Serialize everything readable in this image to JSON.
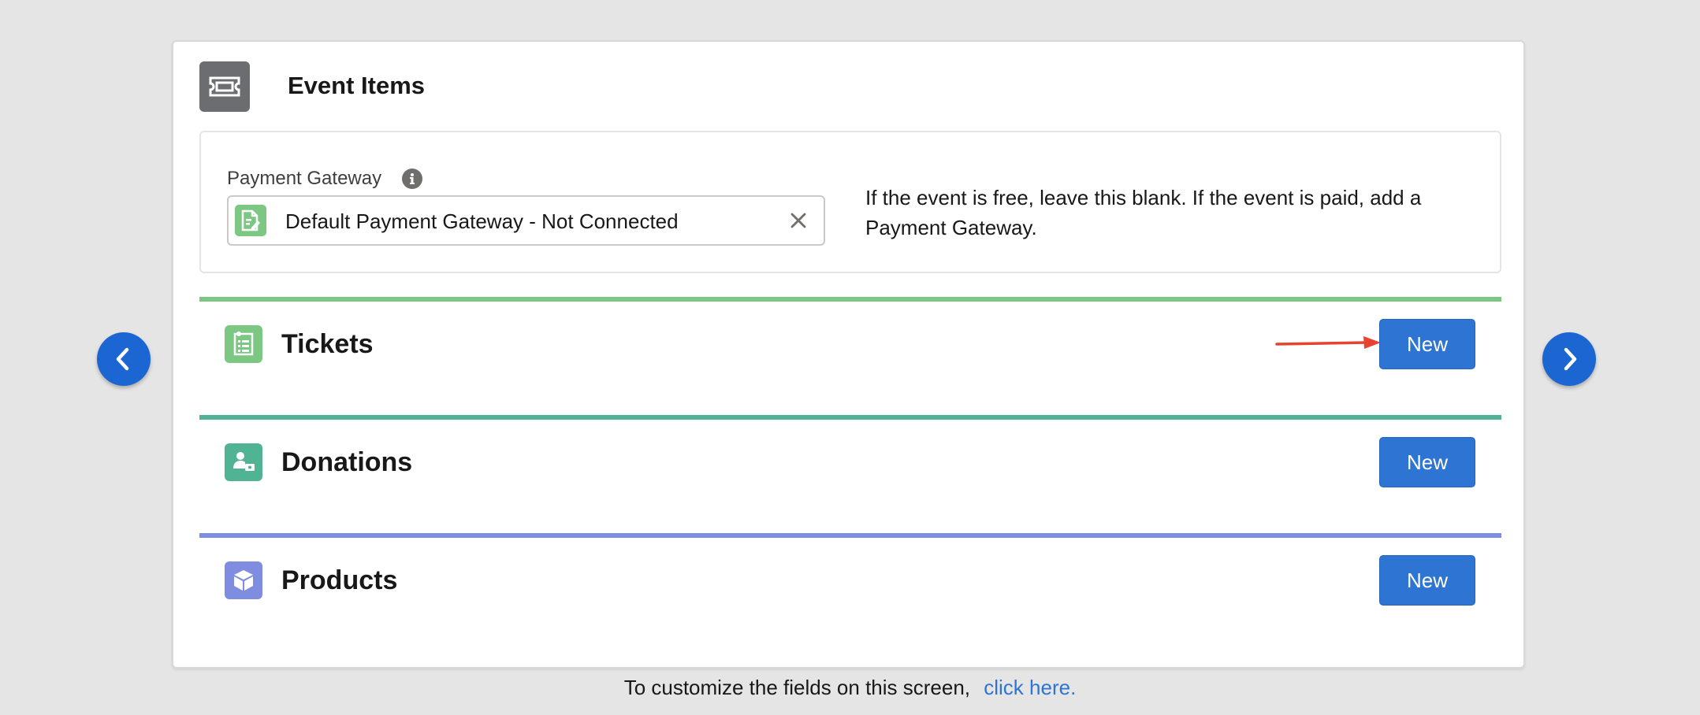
{
  "card": {
    "title": "Event Items",
    "icon": "ticket-icon"
  },
  "payment_gateway": {
    "label": "Payment Gateway",
    "info_icon": "info-icon",
    "value": "Default Payment Gateway - Not Connected",
    "value_icon": "document-edit-icon",
    "clear_icon": "close-icon",
    "help_text": "If the event is free, leave this blank. If the event is paid, add a Payment Gateway."
  },
  "sections": [
    {
      "title": "Tickets",
      "icon": "ticket-list-icon",
      "accent": "#7cc782",
      "button_label": "New"
    },
    {
      "title": "Donations",
      "icon": "donor-icon",
      "accent": "#4fb394",
      "button_label": "New"
    },
    {
      "title": "Products",
      "icon": "box-icon",
      "accent": "#7f8de1",
      "button_label": "New"
    }
  ],
  "navigation": {
    "previous_icon": "chevron-left-icon",
    "next_icon": "chevron-right-icon"
  },
  "annotation": {
    "arrow_color": "#e8432e"
  },
  "footer": {
    "text": "To customize the fields on this screen,",
    "link_label": "click here."
  },
  "colors": {
    "brand": "#2e74d2",
    "background": "#e5e5e5"
  }
}
